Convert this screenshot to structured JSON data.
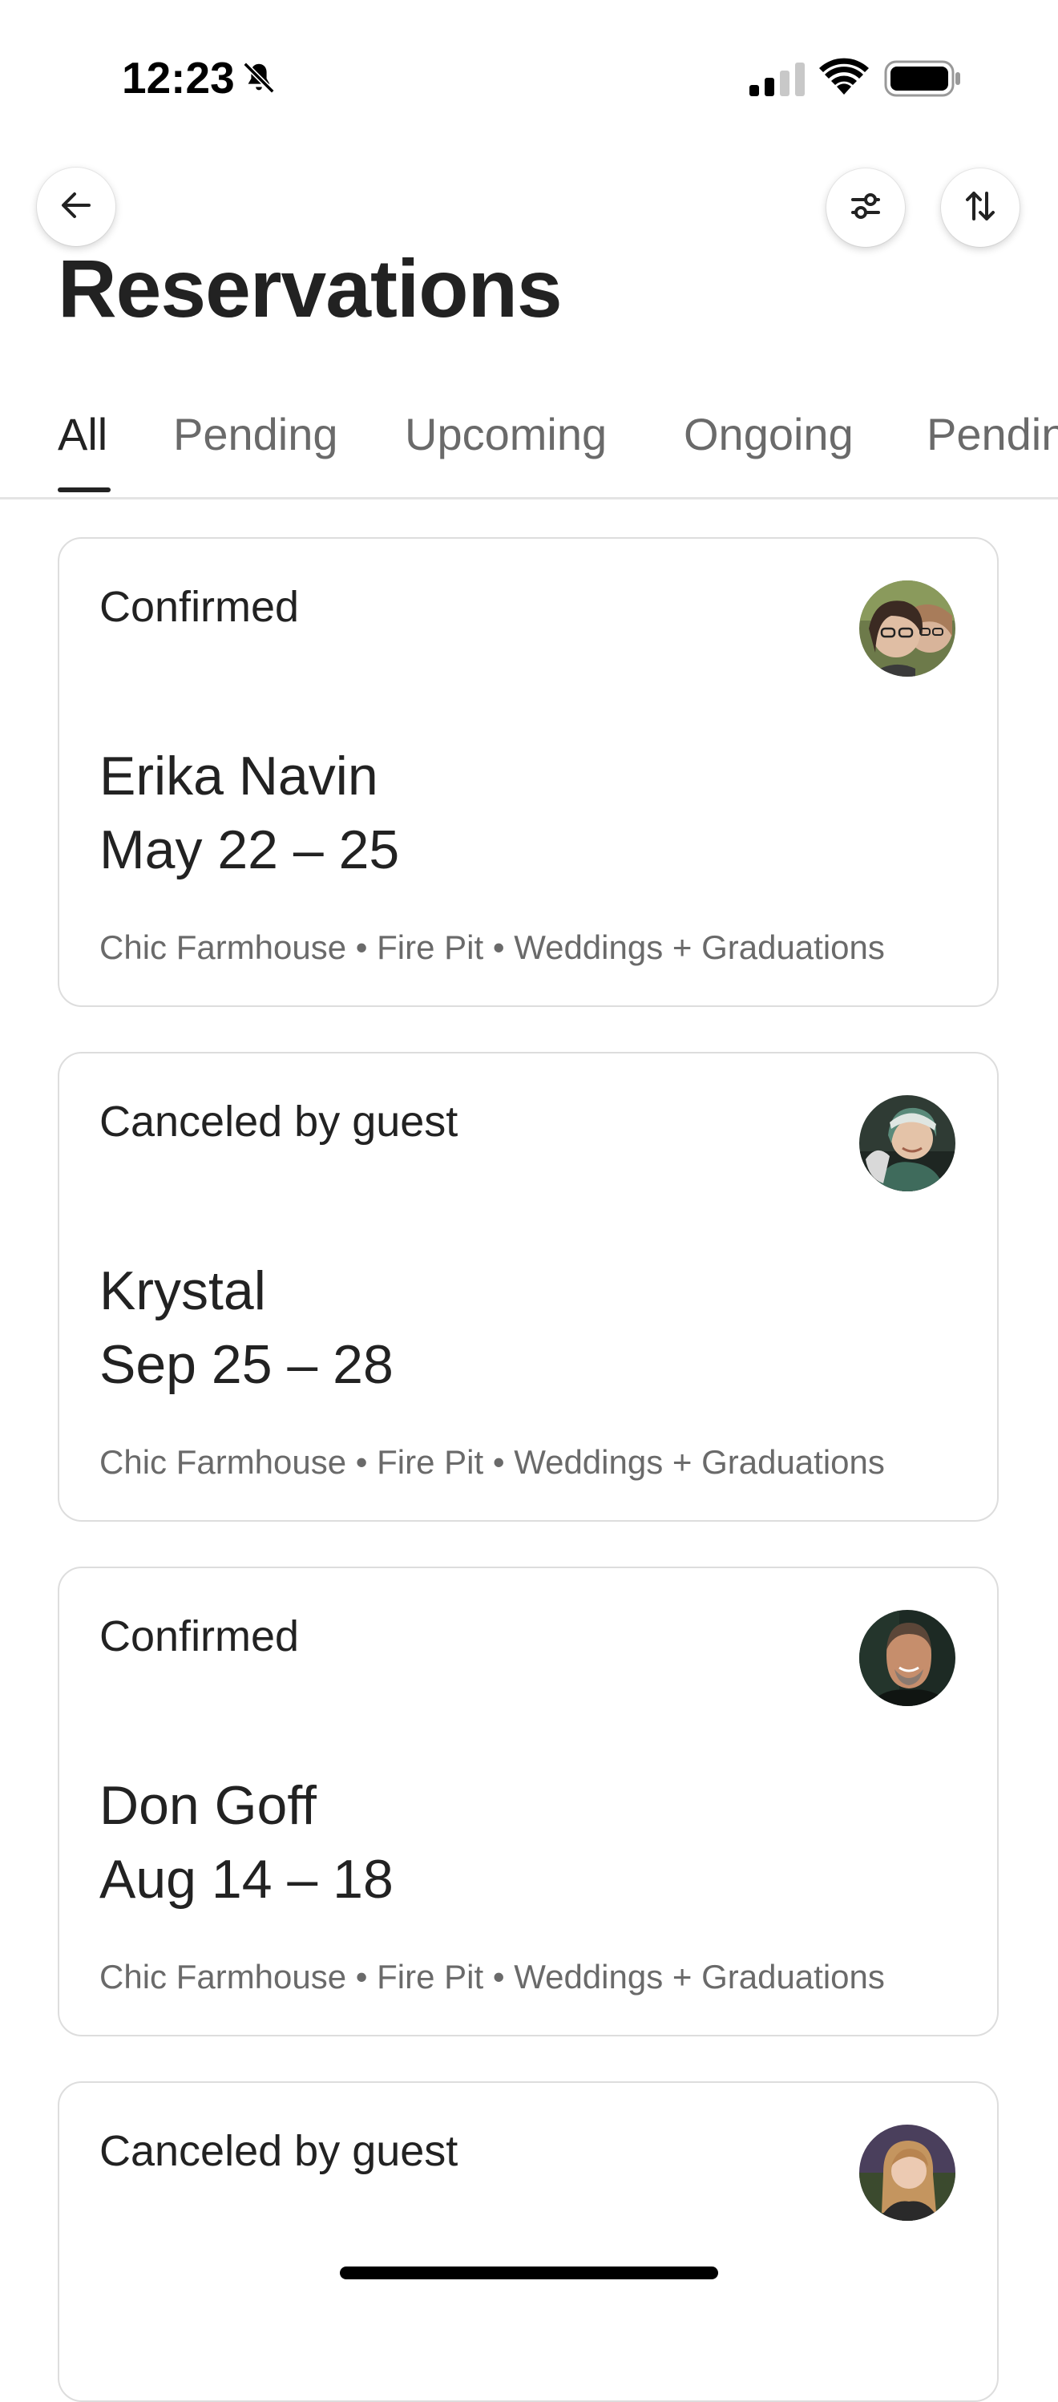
{
  "status_bar": {
    "time": "12:23",
    "icons": [
      "bell-slash-icon",
      "signal-icon",
      "wifi-icon",
      "battery-icon"
    ]
  },
  "header": {
    "back_icon": "arrow-left-icon",
    "filter_icon": "filter-sliders-icon",
    "sort_icon": "sort-arrows-icon",
    "title": "Reservations"
  },
  "tabs": [
    {
      "label": "All",
      "active": true
    },
    {
      "label": "Pending",
      "active": false
    },
    {
      "label": "Upcoming",
      "active": false
    },
    {
      "label": "Ongoing",
      "active": false
    },
    {
      "label": "Pending",
      "active": false
    }
  ],
  "reservations": [
    {
      "status": "Confirmed",
      "guest": "Erika Navin",
      "dates": "May 22 – 25",
      "listing": "Chic Farmhouse • Fire Pit • Weddings + Graduations"
    },
    {
      "status": "Canceled by guest",
      "guest": "Krystal",
      "dates": "Sep 25 – 28",
      "listing": "Chic Farmhouse • Fire Pit • Weddings + Graduations"
    },
    {
      "status": "Confirmed",
      "guest": "Don Goff",
      "dates": "Aug 14 – 18",
      "listing": "Chic Farmhouse • Fire Pit • Weddings + Graduations"
    },
    {
      "status": "Canceled by guest"
    }
  ],
  "colors": {
    "text_primary": "#222222",
    "text_secondary": "#6a6a6a",
    "border": "#dddddd"
  }
}
